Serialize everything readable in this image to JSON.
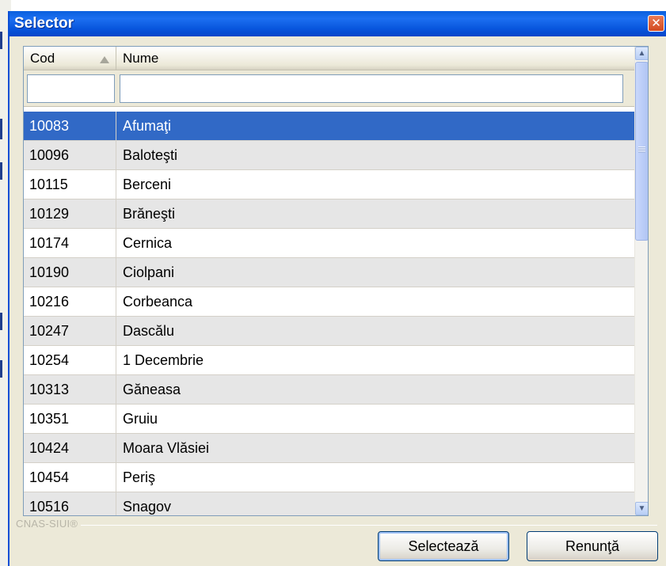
{
  "window": {
    "title": "Selector",
    "close_label": "✕"
  },
  "grid": {
    "columns": [
      {
        "label": "Cod",
        "sorted": "ascending"
      },
      {
        "label": "Nume"
      }
    ],
    "filters": {
      "cod_value": "",
      "nume_value": ""
    },
    "selected_row": 0,
    "rows": [
      {
        "cod": "10083",
        "nume": "Afumaţi"
      },
      {
        "cod": "10096",
        "nume": "Baloteşti"
      },
      {
        "cod": "10115",
        "nume": "Berceni"
      },
      {
        "cod": "10129",
        "nume": "Brăneşti"
      },
      {
        "cod": "10174",
        "nume": "Cernica"
      },
      {
        "cod": "10190",
        "nume": "Ciolpani"
      },
      {
        "cod": "10216",
        "nume": "Corbeanca"
      },
      {
        "cod": "10247",
        "nume": "Dascălu"
      },
      {
        "cod": "10254",
        "nume": "1 Decembrie"
      },
      {
        "cod": "10313",
        "nume": "Găneasa"
      },
      {
        "cod": "10351",
        "nume": "Gruiu"
      },
      {
        "cod": "10424",
        "nume": "Moara Vlăsiei"
      },
      {
        "cod": "10454",
        "nume": "Periş"
      },
      {
        "cod": "10516",
        "nume": "Snagov"
      }
    ]
  },
  "scrollbar": {
    "up_icon": "scroll-up-icon",
    "down_icon": "scroll-down-icon"
  },
  "footer": {
    "watermark": "CNAS-SIUI®",
    "select_label": "Selectează",
    "cancel_label": "Renunţă"
  },
  "colors": {
    "titlebar": "#0a5fdd",
    "selection": "#3169c6",
    "alt_row": "#e6e6e6"
  }
}
